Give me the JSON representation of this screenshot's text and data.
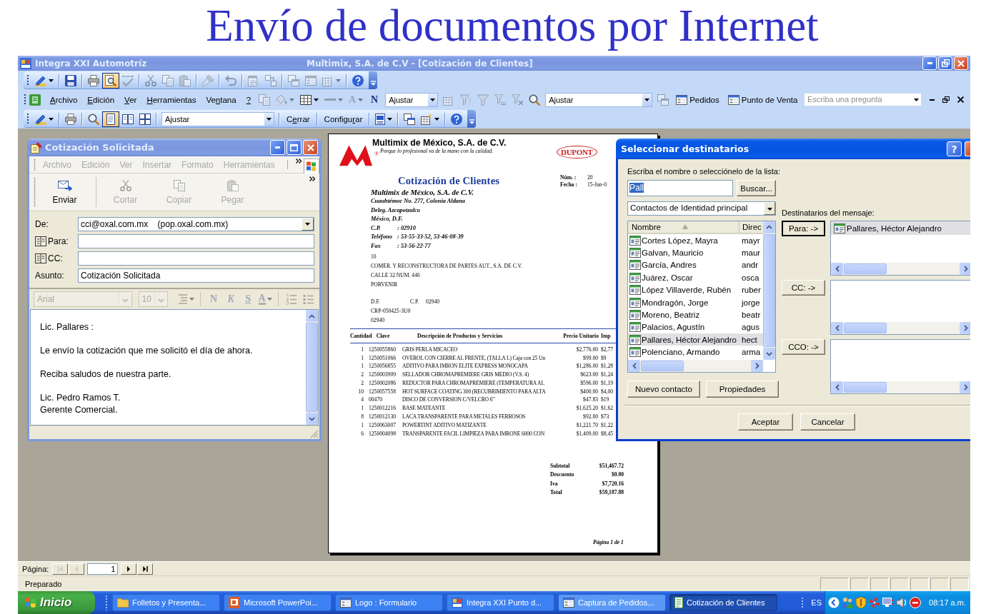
{
  "slide_title": "Envío de documentos por Internet",
  "app_window": {
    "title": "Integra XXI Automotríz",
    "caption": "Multimix, S.A. de C.V - [Cotización de Clientes]",
    "active": false,
    "standard_toolbar": [
      [
        {
          "kind": "design",
          "dropdown": true,
          "disabled": false,
          "pressed": false
        }
      ],
      [
        {
          "kind": "save",
          "disabled": false,
          "pressed": false
        }
      ],
      [
        {
          "kind": "print",
          "disabled": false,
          "pressed": false
        },
        {
          "kind": "preview",
          "disabled": false,
          "pressed": true
        },
        {
          "kind": "spelling",
          "disabled": true,
          "pressed": false
        }
      ],
      [
        {
          "kind": "cut",
          "disabled": true,
          "pressed": false
        },
        {
          "kind": "copy",
          "disabled": true,
          "pressed": false
        },
        {
          "kind": "paste",
          "disabled": true,
          "pressed": false
        }
      ],
      [
        {
          "kind": "brush",
          "disabled": true,
          "pressed": false
        }
      ],
      [
        {
          "kind": "undo",
          "disabled": true,
          "pressed": false
        }
      ],
      [
        {
          "kind": "properties",
          "disabled": true,
          "pressed": false
        },
        {
          "kind": "relations",
          "disabled": true,
          "pressed": false
        }
      ],
      [
        {
          "kind": "window",
          "disabled": true,
          "pressed": false
        },
        {
          "kind": "form",
          "disabled": true,
          "pressed": false
        },
        {
          "kind": "newobject",
          "dropdown": true,
          "disabled": true,
          "pressed": false
        }
      ],
      [
        {
          "kind": "help",
          "disabled": false,
          "pressed": false
        }
      ]
    ],
    "menu_bar": {
      "menus": [
        {
          "key": "A",
          "post": "rchivo"
        },
        {
          "key": "E",
          "post": "dición"
        },
        {
          "key": "V",
          "post": "er"
        },
        {
          "key": "H",
          "post": "erramientas"
        },
        {
          "pre": "Ve",
          "key": "n",
          "post": "tana"
        },
        {
          "key": "?"
        }
      ],
      "tools": [
        [
          {
            "kind": "copy",
            "disabled": true,
            "pressed": false
          },
          {
            "kind": "fill",
            "dropdown": true,
            "disabled": true,
            "pressed": false
          },
          {
            "kind": "grid",
            "dropdown": true,
            "disabled": false,
            "pressed": false
          },
          {
            "kind": "line",
            "dropdown": true,
            "disabled": true,
            "pressed": false
          },
          {
            "kind": "glyph",
            "label": "A",
            "dropdown": true,
            "disabled": true,
            "pressed": false
          },
          {
            "kind": "glyph",
            "label": "N",
            "disabled": false,
            "pressed": false
          },
          {
            "kind": "combo",
            "value": "Ajustar"
          },
          {
            "kind": "newobject",
            "disabled": true,
            "pressed": false
          },
          {
            "kind": "funnelbolt",
            "disabled": true,
            "pressed": false
          },
          {
            "kind": "funnel",
            "disabled": true,
            "pressed": false
          },
          {
            "kind": "funnellines",
            "disabled": true,
            "pressed": false
          },
          {
            "kind": "funnelx",
            "disabled": true,
            "pressed": false
          },
          {
            "kind": "find",
            "disabled": false,
            "pressed": false
          },
          {
            "kind": "combo",
            "value": "Ajustar"
          },
          {
            "kind": "window",
            "disabled": true,
            "pressed": false
          },
          {
            "kind": "shortcut",
            "label": "Pedidos"
          },
          {
            "kind": "shortcut",
            "label": "Punto de Venta"
          }
        ]
      ],
      "help_box": {
        "placeholder": "Escriba una pregunta"
      }
    },
    "preview_toolbar": [
      [
        {
          "kind": "design",
          "dropdown": true,
          "disabled": false,
          "pressed": false
        }
      ],
      [
        {
          "kind": "print",
          "disabled": false,
          "pressed": false
        }
      ],
      [
        {
          "kind": "find",
          "disabled": false,
          "pressed": false
        },
        {
          "kind": "onepage",
          "disabled": false,
          "pressed": true
        },
        {
          "kind": "twopages",
          "disabled": false,
          "pressed": false
        },
        {
          "kind": "multipage",
          "disabled": false,
          "pressed": false
        }
      ],
      [
        {
          "kind": "combo",
          "value": "Ajustar"
        }
      ],
      [
        {
          "kind": "command",
          "label": {
            "pre": "C",
            "key": "e",
            "post": "rrar"
          }
        }
      ],
      [
        {
          "kind": "command",
          "label": {
            "pre": "Configu",
            "key": "r",
            "post": "ar"
          }
        }
      ],
      [
        {
          "kind": "word",
          "dropdown": true,
          "disabled": false,
          "pressed": false
        }
      ],
      [
        {
          "kind": "window",
          "disabled": false,
          "pressed": false
        },
        {
          "kind": "newobject",
          "dropdown": true,
          "disabled": false,
          "pressed": false
        }
      ],
      [
        {
          "kind": "help",
          "disabled": false,
          "pressed": false
        }
      ]
    ],
    "page_nav": {
      "label": "Página:",
      "value": "1",
      "buttons": [
        {
          "kind": "first",
          "disabled": true
        },
        {
          "kind": "prev",
          "disabled": true
        },
        {
          "kind": "next",
          "disabled": false
        },
        {
          "kind": "last",
          "disabled": false
        }
      ]
    },
    "status": "Preparado"
  },
  "message_window": {
    "title": "Cotización Solicitada",
    "active": false,
    "menus": [
      {
        "label": "Archivo",
        "disabled": true
      },
      {
        "label": "Edición",
        "disabled": true
      },
      {
        "label": "Ver",
        "disabled": true
      },
      {
        "label": "Insertar",
        "disabled": true
      },
      {
        "label": "Formato",
        "disabled": true
      },
      {
        "label": "Herramientas",
        "disabled": true
      }
    ],
    "toolbar": [
      {
        "kind": "send",
        "label": "Enviar",
        "disabled": false
      },
      {
        "kind": "cut",
        "label": "Cortar",
        "disabled": true
      },
      {
        "kind": "copy",
        "label": "Copiar",
        "disabled": true
      },
      {
        "kind": "paste",
        "label": "Pegar",
        "disabled": true
      }
    ],
    "fields": [
      {
        "kind": "combo",
        "label": "De:",
        "value": "cci@oxal.com.mx    (pop.oxal.com.mx)"
      },
      {
        "kind": "address",
        "label": "Para:"
      },
      {
        "kind": "address",
        "label": "CC:"
      },
      {
        "kind": "text",
        "label": "Asunto:",
        "value": "Cotización Solicitada"
      }
    ],
    "format_bar": {
      "font": "Arial",
      "size": "10",
      "disabled": true,
      "tools": [
        [
          {
            "kind": "paragraph",
            "dropdown": true,
            "disabled": true
          }
        ],
        [
          {
            "kind": "bold",
            "label": "N",
            "disabled": true
          },
          {
            "kind": "italic",
            "label": "K",
            "disabled": true
          },
          {
            "kind": "underline",
            "label": "S",
            "disabled": true
          },
          {
            "kind": "color",
            "label": "A",
            "dropdown": true,
            "disabled": true
          }
        ],
        [
          {
            "kind": "numbered",
            "disabled": true
          },
          {
            "kind": "bullets",
            "disabled": true
          }
        ]
      ]
    },
    "body": [
      [
        "Lic. Pallares :"
      ],
      [
        "Le envío la cotización que me solicitó el día de ahora."
      ],
      [
        "Reciba saludos de nuestra parte."
      ],
      [
        "Lic. Pedro Ramos T.",
        "Gerente Comercial."
      ]
    ]
  },
  "report": {
    "company": "Multimix de México, S.A. de C.V.",
    "registered_mark": "®",
    "slogan": "Porque lo profesional va de la mano con la calidad.",
    "brand": "DUPONT",
    "title": "Cotización de Clientes",
    "meta": [
      {
        "label": "Núm. :",
        "value": "20"
      },
      {
        "label": "Fecha :",
        "value": "15-Jun-0"
      }
    ],
    "issuer_name": "Multimix de México, S.A. de C.V.",
    "issuer_address": [
      "Cuauhtémoc No. 277, Colonia Aldana",
      "Deleg. Azcapotzalco",
      "México, D.F."
    ],
    "issuer_contacts": [
      {
        "label": "C.P.",
        "value": ": 02910"
      },
      {
        "label": "Teléfono",
        "value": ": 53-55-33-52, 53-46-08-39"
      },
      {
        "label": "Fax",
        "value": ": 53-56-22-77"
      }
    ],
    "customer": [
      "10",
      "COMER. Y RECONSTRUCTORA DE PARTES AUT., S.A. DE C.V.",
      "CALLE 32 NUM. 446",
      "PORVENIR"
    ],
    "customer_city": {
      "city": "D.F.",
      "cp_label": "C.P.",
      "cp": "02940"
    },
    "customer_extra": [
      "CRP-050425-3U0",
      "02940"
    ],
    "columns": [
      "Cantidad",
      "Clave",
      "Descripción de Productos y Servicios",
      "Precio Unitario",
      "Imp"
    ],
    "rows": [
      [
        "1",
        "1250055860",
        "GRIS PERLA MICACEO",
        "$2,776.00",
        "$2,77"
      ],
      [
        "1",
        "1250051066",
        "OVEROL CON CIERRE AL FRENTE, (TALLA L) Caja con 25 Un",
        "$99.00",
        "$9"
      ],
      [
        "1",
        "1250056855",
        "ADITIVO PARA IMRON ELITE EXPRESS MONOCAPA",
        "$1,286.00",
        "$1,28"
      ],
      [
        "2",
        "1250003909",
        "SELLADOR CHROMAPREMIERE GRIS MEDIO (V.S. 4)",
        "$623.00",
        "$1,24"
      ],
      [
        "2",
        "1250002086",
        "REDUCTOR PARA CHROMAPREMIERE (TEMPERATURA AL",
        "$596.00",
        "$1,19"
      ],
      [
        "10",
        "1250057558",
        "HOT SURFACE COATING 300 (RECUBRIMIENTO PARA ALTA",
        "$400.00",
        "$4,00"
      ],
      [
        "4",
        "00470",
        "DISCO DE CONVERSION C/VELCRO 6\"",
        "$47.83",
        "$19"
      ],
      [
        "1",
        "1250012216",
        "BASE MATEANTE",
        "$1,625.20",
        "$1,62"
      ],
      [
        "8",
        "1250012130",
        "LACA TRANSPARENTE PARA METALES FERROSOS",
        "$92.00",
        "$73"
      ],
      [
        "1",
        "1250063007",
        "POWERTINT ADITIVO MATIZANTE",
        "$1,221.70",
        "$1,22"
      ],
      [
        "6",
        "1250004098",
        "TRANSPARENTE FACIL LIMPIEZA PARA IMRONE 6000 CON",
        "$1,409.00",
        "$8,45"
      ]
    ],
    "totals": [
      {
        "label": "Subtotal",
        "value": "$51,467.72"
      },
      {
        "label": "Descuento",
        "value": "$0.00"
      },
      {
        "label": "Iva",
        "value": "$7,720.16"
      },
      {
        "label": "Total",
        "value": "$59,187.88"
      }
    ],
    "footer": "Página 1 de 1"
  },
  "dialog": {
    "title": "Seleccionar destinatarios",
    "active": true,
    "help": "?",
    "prompt": "Escriba el nombre o selecciónelo de la lista:",
    "search": {
      "value": "Pall",
      "highlighted": true
    },
    "search_button": "Buscar...",
    "source": "Contactos de Identidad principal",
    "columns": [
      "Nombre",
      "Direc"
    ],
    "contacts": [
      {
        "name": "Cortes López, Mayra",
        "email": "mayr",
        "selected": false
      },
      {
        "name": "Galvan, Mauricio",
        "email": "maur",
        "selected": false
      },
      {
        "name": "García, Andres",
        "email": "andr",
        "selected": false
      },
      {
        "name": "Juárez, Oscar",
        "email": "osca",
        "selected": false
      },
      {
        "name": "López Villaverde, Rubén",
        "email": "ruber",
        "selected": false
      },
      {
        "name": "Mondragón, Jorge",
        "email": "jorge",
        "selected": false
      },
      {
        "name": "Moreno, Beatriz",
        "email": "beatr",
        "selected": false
      },
      {
        "name": "Palacios, Agustín",
        "email": "agus",
        "selected": false
      },
      {
        "name": "Pallares, Héctor Alejandro",
        "email": "hect",
        "selected": true
      },
      {
        "name": "Polenciano, Armando",
        "email": "arma",
        "selected": false
      }
    ],
    "recipients_label": "Destinatarios del mensaje:",
    "groups": [
      {
        "button": "Para: ->",
        "focused": true,
        "recipients": [
          {
            "name": "Pallares, Héctor Alejandro",
            "selected": true
          }
        ]
      },
      {
        "button": "CC: ->",
        "focused": false
      },
      {
        "button": "CCO: ->",
        "focused": false
      }
    ],
    "actions": [
      "Nuevo contacto",
      "Propiedades"
    ],
    "buttons": [
      "Aceptar",
      "Cancelar"
    ]
  },
  "taskbar": {
    "start": "Inicio",
    "tasks": [
      {
        "kind": "folder",
        "label": "Folletos y Presenta...",
        "selected": false,
        "hovered": false
      },
      {
        "kind": "presentation",
        "label": "Microsoft PowerPoi...",
        "selected": false,
        "hovered": false
      },
      {
        "kind": "form",
        "label": "Logo : Formulario",
        "selected": false,
        "hovered": false
      },
      {
        "kind": "app",
        "label": "Integra XXI Punto d...",
        "selected": false,
        "hovered": false
      },
      {
        "kind": "form",
        "label": "Captura de Pedidos...",
        "selected": false,
        "hovered": true
      },
      {
        "kind": "report",
        "label": "Cotización de Clientes",
        "selected": true,
        "hovered": false
      }
    ],
    "language": "ES",
    "clock": "08:17 a.m."
  }
}
